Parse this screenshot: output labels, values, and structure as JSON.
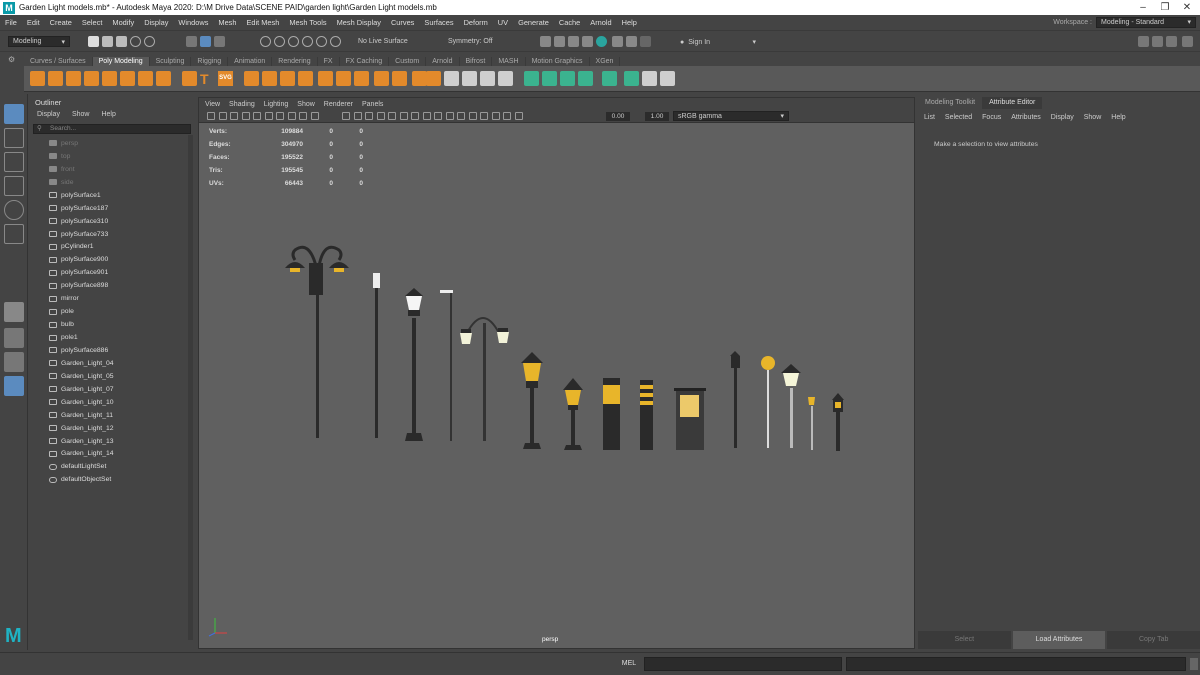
{
  "window": {
    "title": "Garden Light models.mb* - Autodesk Maya 2020: D:\\M Drive Data\\SCENE PAID\\garden light\\Garden Light models.mb",
    "logo_letter": "M"
  },
  "menubar": [
    "File",
    "Edit",
    "Create",
    "Select",
    "Modify",
    "Display",
    "Windows",
    "Mesh",
    "Edit Mesh",
    "Mesh Tools",
    "Mesh Display",
    "Curves",
    "Surfaces",
    "Deform",
    "UV",
    "Generate",
    "Cache",
    "Arnold",
    "Help"
  ],
  "workspace": {
    "label": "Workspace :",
    "value": "Modeling - Standard"
  },
  "statusline": {
    "mode": "Modeling",
    "live_surface": "No Live Surface",
    "symmetry": "Symmetry: Off",
    "sign_in": "Sign In"
  },
  "shelf_tabs": [
    "Curves / Surfaces",
    "Poly Modeling",
    "Sculpting",
    "Rigging",
    "Animation",
    "Rendering",
    "FX",
    "FX Caching",
    "Custom",
    "Arnold",
    "Bifrost",
    "MASH",
    "Motion Graphics",
    "XGen"
  ],
  "shelf_active": "Poly Modeling",
  "shelf_text_icons": {
    "text_tool": "T",
    "svg_tool": "SVG"
  },
  "outliner": {
    "title": "Outliner",
    "menu": [
      "Display",
      "Show",
      "Help"
    ],
    "search_placeholder": "Search...",
    "items": [
      {
        "label": "persp",
        "type": "camera",
        "dim": true
      },
      {
        "label": "top",
        "type": "camera",
        "dim": true
      },
      {
        "label": "front",
        "type": "camera",
        "dim": true
      },
      {
        "label": "side",
        "type": "camera",
        "dim": true
      },
      {
        "label": "polySurface1",
        "type": "mesh",
        "dim": false
      },
      {
        "label": "polySurface187",
        "type": "mesh",
        "dim": false
      },
      {
        "label": "polySurface310",
        "type": "mesh",
        "dim": false
      },
      {
        "label": "polySurface733",
        "type": "mesh",
        "dim": false
      },
      {
        "label": "pCylinder1",
        "type": "mesh",
        "dim": false
      },
      {
        "label": "polySurface900",
        "type": "mesh",
        "dim": false
      },
      {
        "label": "polySurface901",
        "type": "mesh",
        "dim": false
      },
      {
        "label": "polySurface898",
        "type": "mesh",
        "dim": false
      },
      {
        "label": "mirror",
        "type": "mesh",
        "dim": false
      },
      {
        "label": "pole",
        "type": "mesh",
        "dim": false
      },
      {
        "label": "bulb",
        "type": "mesh",
        "dim": false
      },
      {
        "label": "pole1",
        "type": "mesh",
        "dim": false
      },
      {
        "label": "polySurface886",
        "type": "mesh",
        "dim": false
      },
      {
        "label": "Garden_Light_04",
        "type": "mesh",
        "dim": false
      },
      {
        "label": "Garden_Light_05",
        "type": "mesh",
        "dim": false
      },
      {
        "label": "Garden_Light_07",
        "type": "mesh",
        "dim": false
      },
      {
        "label": "Garden_Light_10",
        "type": "mesh",
        "dim": false
      },
      {
        "label": "Garden_Light_11",
        "type": "mesh",
        "dim": false
      },
      {
        "label": "Garden_Light_12",
        "type": "mesh",
        "dim": false
      },
      {
        "label": "Garden_Light_13",
        "type": "mesh",
        "dim": false
      },
      {
        "label": "Garden_Light_14",
        "type": "mesh",
        "dim": false
      },
      {
        "label": "defaultLightSet",
        "type": "set",
        "dim": false
      },
      {
        "label": "defaultObjectSet",
        "type": "set",
        "dim": false
      }
    ]
  },
  "viewport": {
    "menu": [
      "View",
      "Shading",
      "Lighting",
      "Show",
      "Renderer",
      "Panels"
    ],
    "exposure": "0.00",
    "gamma": "1.00",
    "color_space": "sRGB gamma",
    "camera_label": "persp",
    "hud": [
      {
        "label": "Verts:",
        "total": "109884",
        "sel": "0",
        "comp": "0"
      },
      {
        "label": "Edges:",
        "total": "304970",
        "sel": "0",
        "comp": "0"
      },
      {
        "label": "Faces:",
        "total": "195522",
        "sel": "0",
        "comp": "0"
      },
      {
        "label": "Tris:",
        "total": "195545",
        "sel": "0",
        "comp": "0"
      },
      {
        "label": "UVs:",
        "total": "66443",
        "sel": "0",
        "comp": "0"
      }
    ]
  },
  "attribute_panel": {
    "tabs": [
      "Modeling Toolkit",
      "Attribute Editor"
    ],
    "active_tab": "Attribute Editor",
    "menu": [
      "List",
      "Selected",
      "Focus",
      "Attributes",
      "Display",
      "Show",
      "Help"
    ],
    "message": "Make a selection to view attributes",
    "buttons": [
      "Select",
      "Load Attributes",
      "Copy Tab"
    ]
  },
  "bottom": {
    "mel_label": "MEL"
  },
  "colors": {
    "shelf_orange": "#e38a2b",
    "shelf_green": "#3bb38f",
    "lamp_yellow": "#e8b52a",
    "viewport_bg": "#606060"
  }
}
